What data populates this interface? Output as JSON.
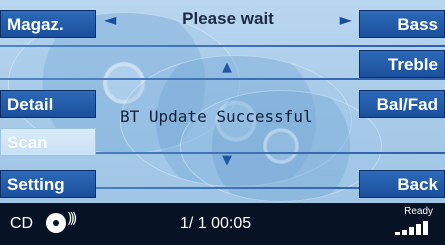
{
  "top": {
    "status_title": "Please wait",
    "left_arrow": "◄",
    "right_arrow": "►"
  },
  "left_menu": [
    "Magaz.",
    "Detail",
    "Scan",
    "Setting"
  ],
  "right_menu": [
    "Bass",
    "Treble",
    "Bal/Fad",
    "Back"
  ],
  "center": {
    "up_arrow": "▲",
    "down_arrow": "▼",
    "message": "BT Update Successful"
  },
  "bottom": {
    "source": "CD",
    "track_time": "1/ 1 00:05",
    "ready": "Ready"
  }
}
